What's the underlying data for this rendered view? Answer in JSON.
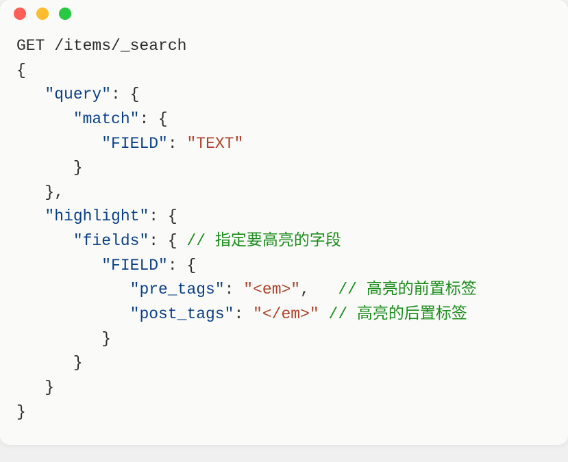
{
  "window": {
    "traffic_lights": [
      "close",
      "minimize",
      "zoom"
    ]
  },
  "code": {
    "line1": "GET /items/_search",
    "line2": "{",
    "line3_indent": "   ",
    "line3_key": "\"query\"",
    "line3_after": ": {",
    "line4_indent": "      ",
    "line4_key": "\"match\"",
    "line4_after": ": {",
    "line5_indent": "         ",
    "line5_key": "\"FIELD\"",
    "line5_colon": ": ",
    "line5_val": "\"TEXT\"",
    "line6_indent": "      ",
    "line6_text": "}",
    "line7_indent": "   ",
    "line7_text": "},",
    "line8_indent": "   ",
    "line8_key": "\"highlight\"",
    "line8_after": ": {",
    "line9_indent": "      ",
    "line9_key": "\"fields\"",
    "line9_after": ": { ",
    "line9_comment": "// 指定要高亮的字段",
    "line10_indent": "         ",
    "line10_key": "\"FIELD\"",
    "line10_after": ": {",
    "line11_indent": "            ",
    "line11_key": "\"pre_tags\"",
    "line11_colon": ": ",
    "line11_val": "\"<em>\"",
    "line11_comma": ",   ",
    "line11_comment": "// 高亮的前置标签",
    "line12_indent": "            ",
    "line12_key": "\"post_tags\"",
    "line12_colon": ": ",
    "line12_val": "\"</em>\"",
    "line12_space": " ",
    "line12_comment": "// 高亮的后置标签",
    "line13_indent": "         ",
    "line13_text": "}",
    "line14_indent": "      ",
    "line14_text": "}",
    "line15_indent": "   ",
    "line15_text": "}",
    "line16": "}"
  }
}
